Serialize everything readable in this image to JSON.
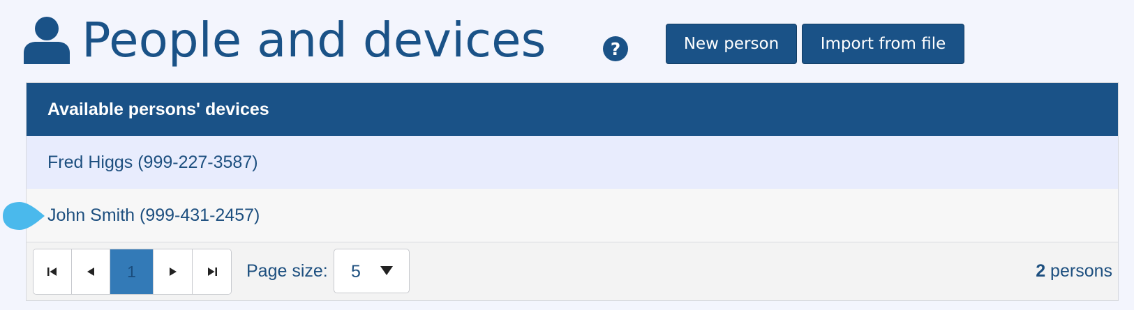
{
  "header": {
    "title": "People and devices",
    "icon": "person-icon",
    "help_icon": "question-circle-icon",
    "buttons": {
      "new_person": "New person",
      "import_from_file": "Import from file"
    }
  },
  "table": {
    "header": "Available persons' devices",
    "rows": [
      "Fred Higgs (999-227-3587)",
      "John Smith (999-431-2457)"
    ]
  },
  "pager": {
    "current_page": "1",
    "page_size_label": "Page size:",
    "page_size_value": "5",
    "total_count": "2",
    "total_label": " persons"
  },
  "colors": {
    "primary": "#1a5287",
    "background": "#f3f5fd",
    "row_highlight": "#e8ecfd",
    "current_page": "#337ab7",
    "pointer_marker": "#4ab9ec"
  }
}
